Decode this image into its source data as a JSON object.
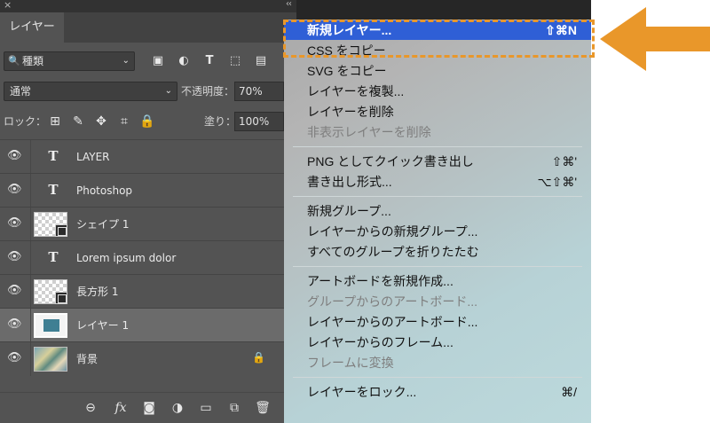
{
  "panel": {
    "close_glyph": "×",
    "collapse_glyph": "‹‹",
    "tab_label": "レイヤー",
    "filter": {
      "value": "種類",
      "search_glyph": "🔍",
      "chevron": "⌄",
      "icons": [
        {
          "name": "pixel-filter-icon",
          "glyph": "▣"
        },
        {
          "name": "adjustment-filter-icon",
          "glyph": "◐"
        },
        {
          "name": "type-filter-icon",
          "glyph": "T"
        },
        {
          "name": "shape-filter-icon",
          "glyph": "⬚"
        },
        {
          "name": "smart-object-filter-icon",
          "glyph": "▤"
        }
      ]
    },
    "blend": {
      "mode": "通常",
      "chevron": "⌄",
      "opacity_label": "不透明度：",
      "opacity_value": "70%"
    },
    "lock": {
      "label": "ロック：",
      "icons": [
        {
          "name": "lock-transparent-pixels-icon",
          "glyph": "⊞"
        },
        {
          "name": "lock-image-pixels-icon",
          "glyph": "✎"
        },
        {
          "name": "lock-position-icon",
          "glyph": "✥"
        },
        {
          "name": "lock-artboard-icon",
          "glyph": "⌗"
        },
        {
          "name": "lock-all-icon",
          "glyph": "🔒"
        }
      ],
      "fill_label": "塗り：",
      "fill_value": "100%"
    },
    "layers": [
      {
        "name": "LAYER",
        "kind": "text",
        "selected": false
      },
      {
        "name": "Photoshop",
        "kind": "text",
        "selected": false
      },
      {
        "name": "シェイプ 1",
        "kind": "shape",
        "selected": false
      },
      {
        "name": "Lorem ipsum dolor",
        "kind": "text",
        "selected": false
      },
      {
        "name": "長方形 1",
        "kind": "shape",
        "selected": false
      },
      {
        "name": "レイヤー 1",
        "kind": "pixel",
        "selected": true
      },
      {
        "name": "背景",
        "kind": "photo",
        "selected": false,
        "locked": true
      }
    ],
    "eye_glyph": "👁",
    "t_glyph": "T",
    "lock_glyph": "🔒",
    "bottom_icons": [
      {
        "name": "link-layers-icon",
        "glyph": "⊖"
      },
      {
        "name": "layer-style-icon",
        "glyph": "fx"
      },
      {
        "name": "layer-mask-icon",
        "glyph": "◙"
      },
      {
        "name": "adjustment-layer-icon",
        "glyph": "◑"
      },
      {
        "name": "new-group-icon",
        "glyph": "▭"
      },
      {
        "name": "new-layer-icon",
        "glyph": "⧉"
      },
      {
        "name": "delete-layer-icon",
        "glyph": "🗑"
      }
    ]
  },
  "menu": {
    "items": [
      {
        "label": "新規レイヤー...",
        "shortcut": "⇧⌘N",
        "highlighted": true
      },
      {
        "label": "CSS をコピー",
        "shortcut": ""
      },
      {
        "label": "SVG をコピー",
        "shortcut": ""
      },
      {
        "label": "レイヤーを複製...",
        "shortcut": ""
      },
      {
        "label": "レイヤーを削除",
        "shortcut": ""
      },
      {
        "label": "非表示レイヤーを削除",
        "shortcut": "",
        "disabled": true
      },
      {
        "separator": true
      },
      {
        "label": "PNG としてクイック書き出し",
        "shortcut": "⇧⌘'"
      },
      {
        "label": "書き出し形式...",
        "shortcut": "⌥⇧⌘'"
      },
      {
        "separator": true
      },
      {
        "label": "新規グループ...",
        "shortcut": ""
      },
      {
        "label": "レイヤーからの新規グループ...",
        "shortcut": ""
      },
      {
        "label": "すべてのグループを折りたたむ",
        "shortcut": ""
      },
      {
        "separator": true
      },
      {
        "label": "アートボードを新規作成...",
        "shortcut": ""
      },
      {
        "label": "グループからのアートボード...",
        "shortcut": "",
        "disabled": true
      },
      {
        "label": "レイヤーからのアートボード...",
        "shortcut": ""
      },
      {
        "label": "レイヤーからのフレーム...",
        "shortcut": ""
      },
      {
        "label": "フレームに変換",
        "shortcut": "",
        "disabled": true
      },
      {
        "separator": true
      },
      {
        "label": "レイヤーをロック...",
        "shortcut": "⌘/"
      }
    ],
    "highlight_color": "#2f5fd6"
  },
  "annotation": {
    "arrow_color": "#e9972a",
    "dash_color": "#e9972a"
  }
}
